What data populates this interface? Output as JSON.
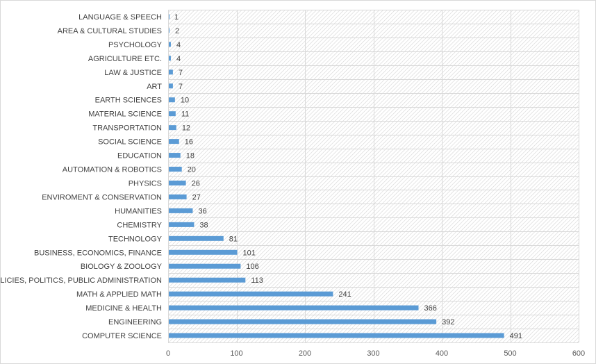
{
  "chart_data": {
    "type": "bar",
    "orientation": "horizontal",
    "title": "",
    "xlabel": "",
    "ylabel": "",
    "xlim": [
      0,
      600
    ],
    "xticks": [
      0,
      100,
      200,
      300,
      400,
      500,
      600
    ],
    "grid": true,
    "legend": "none",
    "bar_color": "#5b9bd5",
    "categories": [
      "LANGUAGE & SPEECH",
      "AREA & CULTURAL STUDIES",
      "PSYCHOLOGY",
      "AGRICULTURE ETC.",
      "LAW & JUSTICE",
      "ART",
      "EARTH SCIENCES",
      "MATERIAL SCIENCE",
      "TRANSPORTATION",
      "SOCIAL SCIENCE",
      "EDUCATION",
      "AUTOMATION & ROBOTICS",
      "PHYSICS",
      "ENVIROMENT & CONSERVATION",
      "HUMANITIES",
      "CHEMISTRY",
      "TECHNOLOGY",
      "BUSINESS, ECONOMICS, FINANCE",
      "BIOLOGY & ZOOLOGY",
      "POLICIES, POLITICS, PUBLIC ADMINISTRATION",
      "MATH & APPLIED MATH",
      "MEDICINE & HEALTH",
      "ENGINEERING",
      "COMPUTER SCIENCE"
    ],
    "values": [
      1,
      2,
      4,
      4,
      7,
      7,
      10,
      11,
      12,
      16,
      18,
      20,
      26,
      27,
      36,
      38,
      81,
      101,
      106,
      113,
      241,
      366,
      392,
      491
    ]
  }
}
